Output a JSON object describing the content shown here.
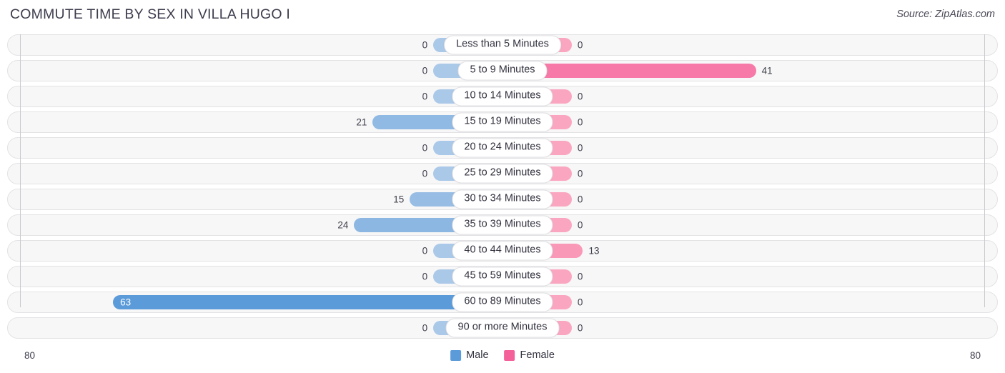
{
  "header": {
    "title": "COMMUTE TIME BY SEX IN VILLA HUGO I",
    "source": "Source: ZipAtlas.com"
  },
  "axis": {
    "left_max": "80",
    "right_max": "80"
  },
  "legend": {
    "items": [
      {
        "label": "Male",
        "color": "#5b9bd9"
      },
      {
        "label": "Female",
        "color": "#f4619a"
      }
    ]
  },
  "chart_data": {
    "type": "bar",
    "subtype": "diverging-horizontal-bar",
    "title": "COMMUTE TIME BY SEX IN VILLA HUGO I",
    "xlabel": "",
    "ylabel": "",
    "xlim": [
      80,
      80
    ],
    "axis_max": 80,
    "grid": false,
    "legend_position": "bottom-center",
    "categories": [
      "Less than 5 Minutes",
      "5 to 9 Minutes",
      "10 to 14 Minutes",
      "15 to 19 Minutes",
      "20 to 24 Minutes",
      "25 to 29 Minutes",
      "30 to 34 Minutes",
      "35 to 39 Minutes",
      "40 to 44 Minutes",
      "45 to 59 Minutes",
      "60 to 89 Minutes",
      "90 or more Minutes"
    ],
    "series": [
      {
        "name": "Male",
        "direction": "left",
        "color": "#5b9bd9",
        "values": [
          0,
          0,
          0,
          21,
          0,
          0,
          15,
          24,
          0,
          0,
          63,
          0
        ],
        "labels": [
          "0",
          "0",
          "0",
          "21",
          "0",
          "0",
          "15",
          "24",
          "0",
          "0",
          "63",
          "0"
        ]
      },
      {
        "name": "Female",
        "direction": "right",
        "color": "#f4619a",
        "values": [
          0,
          41,
          0,
          0,
          0,
          0,
          0,
          0,
          13,
          0,
          0,
          0
        ],
        "labels": [
          "0",
          "41",
          "0",
          "0",
          "0",
          "0",
          "0",
          "0",
          "13",
          "0",
          "0",
          "0"
        ]
      }
    ]
  }
}
